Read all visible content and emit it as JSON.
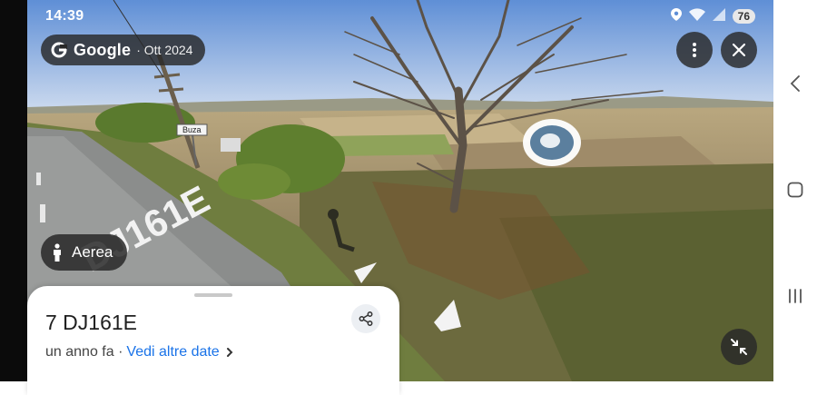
{
  "status_bar": {
    "time": "14:39",
    "battery": "76"
  },
  "header": {
    "brand": "Google",
    "capture_date": "· Ott 2024"
  },
  "controls": {
    "aerial_label": "Aerea"
  },
  "scene": {
    "sign_text": "Buza",
    "road_marking": "DJ161E"
  },
  "card": {
    "title": "7 DJ161E",
    "relative_date": "un anno fa ·",
    "more_dates_link": "Vedi altre date"
  },
  "colors": {
    "sky_top": "#5f8fd6",
    "sky_bottom": "#cfdcef",
    "grass": "#7f8f4a",
    "road": "#8b8d8c",
    "link": "#1a73e8",
    "pill_bg": "#282828"
  },
  "icons": [
    "google-g-icon",
    "location-icon",
    "wifi-icon",
    "signal-icon",
    "more-vert-icon",
    "close-icon",
    "person-icon",
    "share-icon",
    "chevron-right-icon",
    "collapse-icon",
    "back-icon",
    "home-icon",
    "recents-icon"
  ]
}
